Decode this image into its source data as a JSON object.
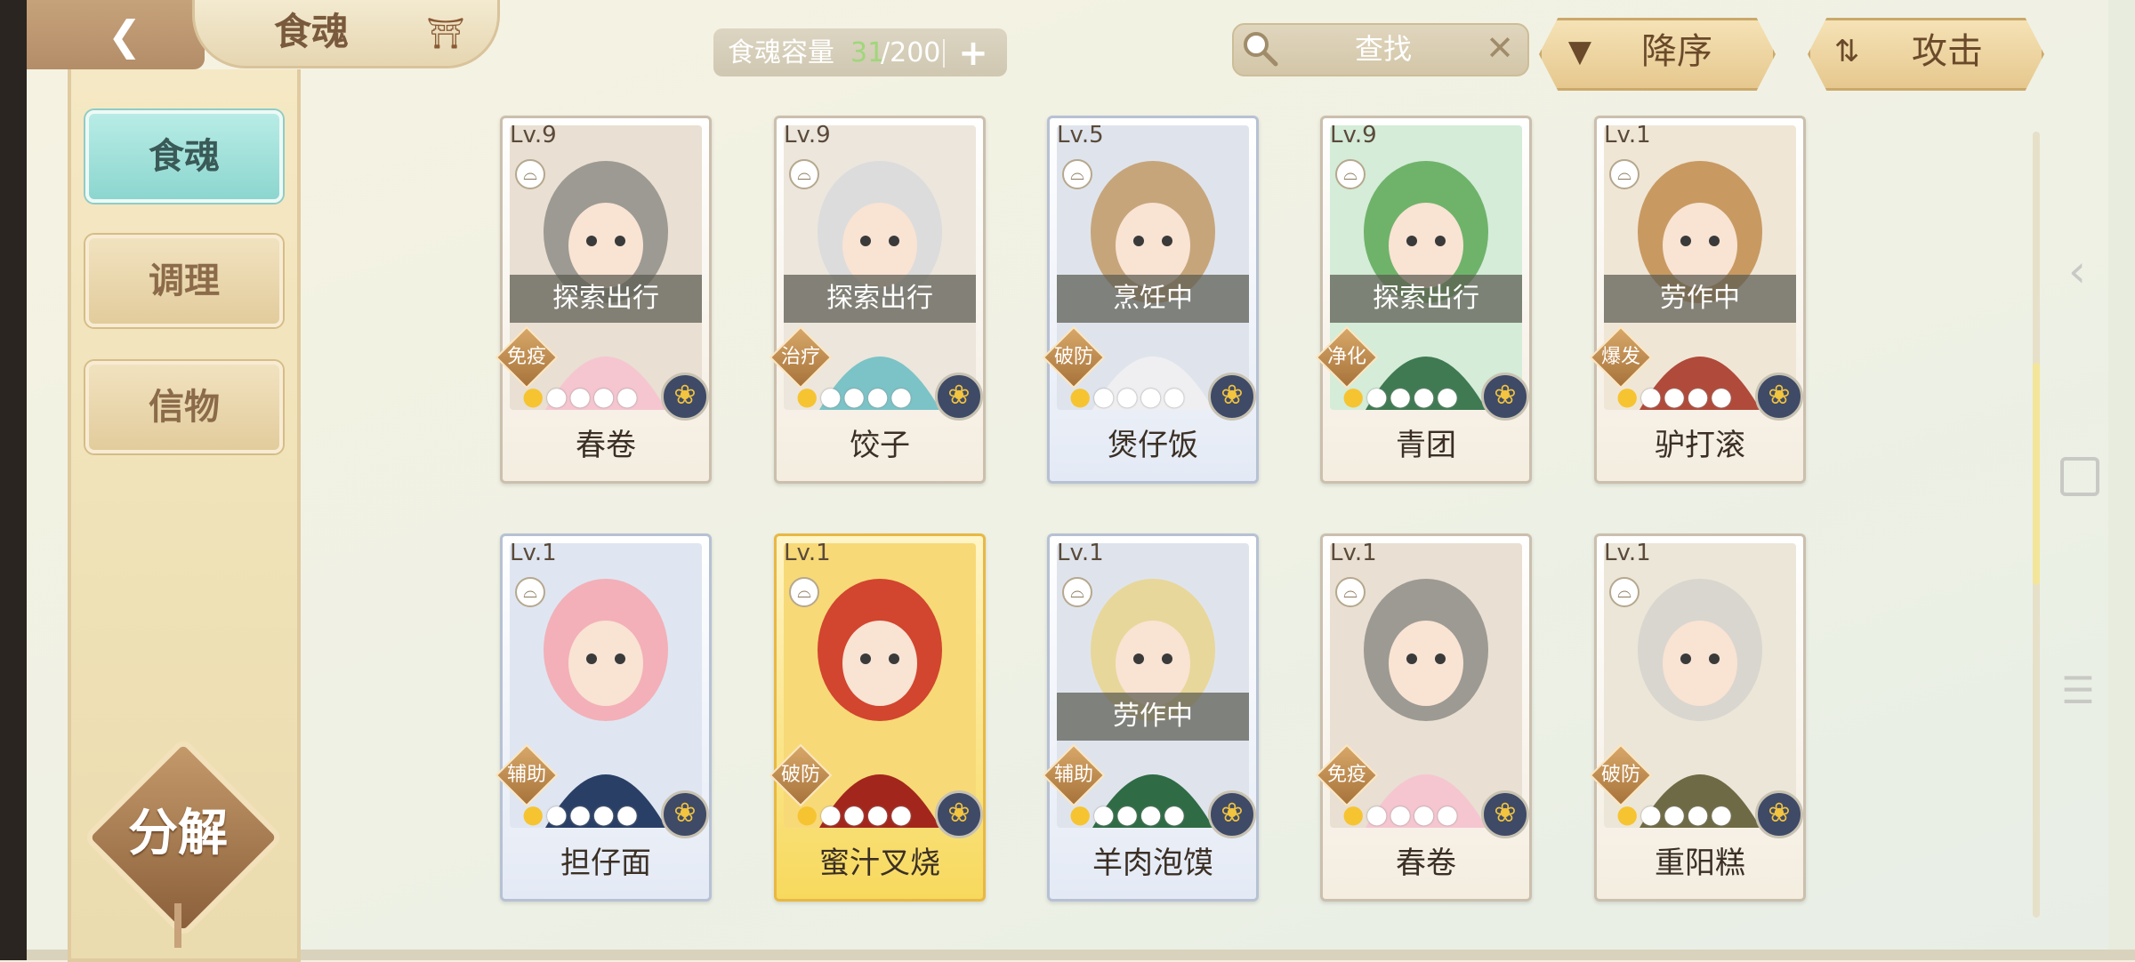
{
  "header": {
    "title": "食魂",
    "capacity_label": "食魂容量",
    "capacity_current": "31",
    "capacity_max": "/200",
    "add_label": "+",
    "search_placeholder": "查找",
    "clear_label": "✕",
    "sort_label": "降序",
    "attr_label": "攻击"
  },
  "sidebar": {
    "tabs": [
      {
        "label": "食魂",
        "active": true
      },
      {
        "label": "调理",
        "active": false
      },
      {
        "label": "信物",
        "active": false
      }
    ],
    "decompose_label": "分解"
  },
  "colors": {
    "capacity_current": "#9fd77a",
    "active_tab": "#8cd6cf",
    "star_on": "#f6c431"
  },
  "cards": [
    {
      "level": "Lv.9",
      "name": "春卷",
      "status": "探索出行",
      "role": "免疫",
      "stars": 1,
      "stars_total": 5,
      "tone": "normal",
      "palette": [
        "#e9dfd2",
        "#9c9a93",
        "#f5c6d0"
      ]
    },
    {
      "level": "Lv.9",
      "name": "饺子",
      "status": "探索出行",
      "role": "治疗",
      "stars": 1,
      "stars_total": 5,
      "tone": "normal",
      "palette": [
        "#ece6dc",
        "#dcdcdc",
        "#7bc3c7"
      ]
    },
    {
      "level": "Lv.5",
      "name": "煲仔饭",
      "status": "烹饪中",
      "role": "破防",
      "stars": 1,
      "stars_total": 5,
      "tone": "blue",
      "palette": [
        "#dfe4ec",
        "#c7a57b",
        "#efeff2"
      ]
    },
    {
      "level": "Lv.9",
      "name": "青团",
      "status": "探索出行",
      "role": "净化",
      "stars": 1,
      "stars_total": 5,
      "tone": "normal",
      "palette": [
        "#d4ecd8",
        "#6fb36a",
        "#3f7a52"
      ]
    },
    {
      "level": "Lv.1",
      "name": "驴打滚",
      "status": "劳作中",
      "role": "爆发",
      "stars": 1,
      "stars_total": 5,
      "tone": "normal",
      "palette": [
        "#f0e6d6",
        "#c89a62",
        "#b04a3a"
      ]
    },
    {
      "level": "Lv.1",
      "name": "担仔面",
      "status": "",
      "role": "辅助",
      "stars": 1,
      "stars_total": 5,
      "tone": "blue",
      "palette": [
        "#dfe6f1",
        "#f3b0b8",
        "#2a3f66"
      ]
    },
    {
      "level": "Lv.1",
      "name": "蜜汁叉烧",
      "status": "",
      "role": "破防",
      "stars": 1,
      "stars_total": 5,
      "tone": "gold",
      "palette": [
        "#f8d977",
        "#d2452f",
        "#a3261c"
      ]
    },
    {
      "level": "Lv.1",
      "name": "羊肉泡馍",
      "status": "劳作中",
      "role": "辅助",
      "stars": 1,
      "stars_total": 5,
      "tone": "blue",
      "palette": [
        "#dfe4ec",
        "#e8d79a",
        "#2f6b45"
      ]
    },
    {
      "level": "Lv.1",
      "name": "春卷",
      "status": "",
      "role": "免疫",
      "stars": 1,
      "stars_total": 5,
      "tone": "normal",
      "palette": [
        "#e9dfd2",
        "#9c9a93",
        "#f5c6d0"
      ]
    },
    {
      "level": "Lv.1",
      "name": "重阳糕",
      "status": "",
      "role": "破防",
      "stars": 1,
      "stars_total": 5,
      "tone": "normal",
      "palette": [
        "#ece6d8",
        "#d9d6cf",
        "#6e6a45"
      ]
    }
  ]
}
